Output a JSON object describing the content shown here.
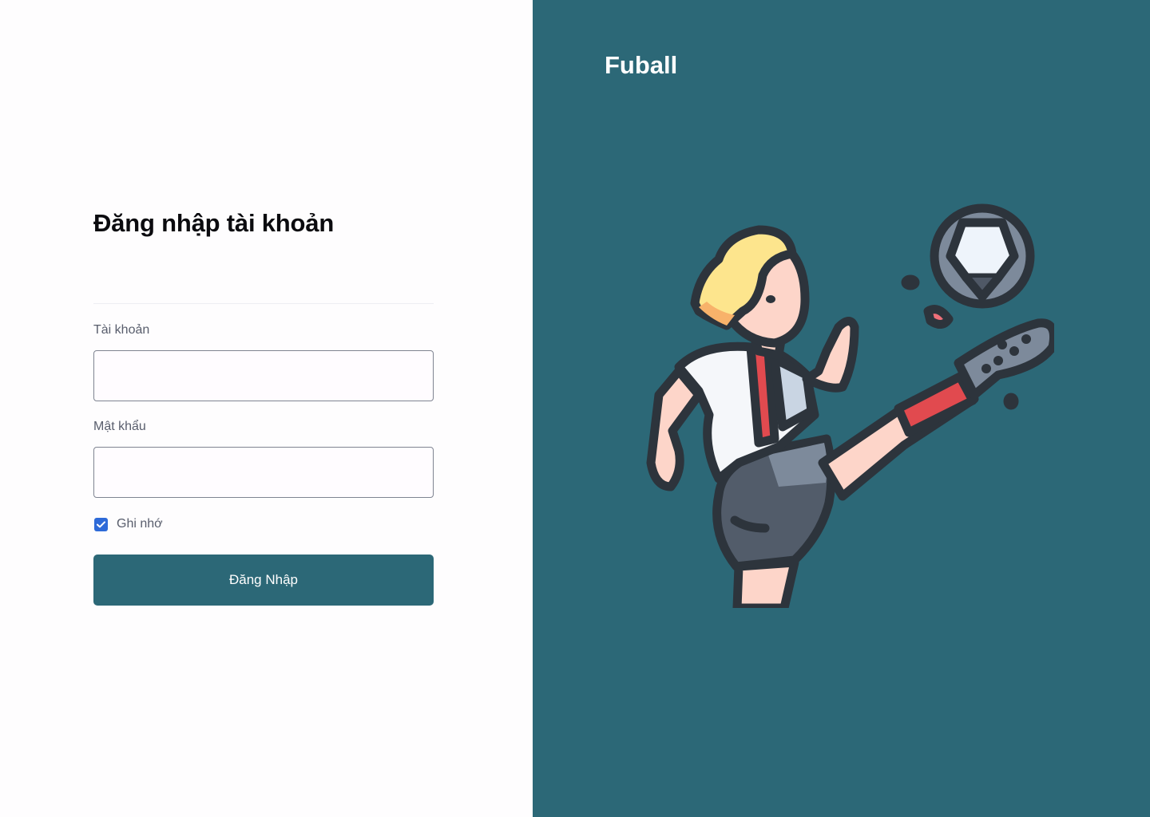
{
  "login": {
    "title": "Đăng nhập tài khoản",
    "username_label": "Tài khoản",
    "username_value": "",
    "password_label": "Mật khẩu",
    "password_value": "",
    "remember_label": "Ghi nhớ",
    "remember_checked": true,
    "submit_label": "Đăng Nhập"
  },
  "brand": {
    "name": "Fuball"
  },
  "illustration": {
    "icon": "football-player-kicking-ball-icon"
  },
  "colors": {
    "primary": "#2c6877",
    "checkbox": "#2e6ad8",
    "label_text": "#585d6c",
    "title_text": "#0b0b0f"
  }
}
